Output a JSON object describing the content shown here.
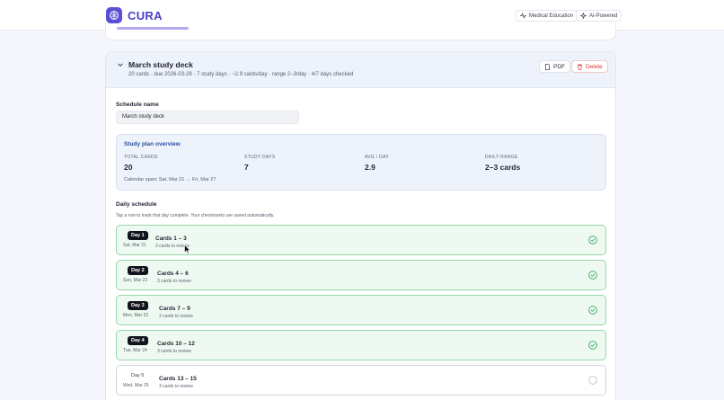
{
  "header": {
    "brand": "CURA",
    "pills": [
      {
        "label": "Medical Education",
        "icon": "pulse-icon"
      },
      {
        "label": "AI-Powered",
        "icon": "sparkle-icon"
      }
    ]
  },
  "deck": {
    "title": "March study deck",
    "meta": "20 cards · due 2026-03-28 · 7 study days · ~2.9 cards/day · range 2–3/day · 4/7 days checked",
    "pdf_label": "PDF",
    "delete_label": "Delete",
    "schedule_name_label": "Schedule name",
    "schedule_name_value": "March study deck"
  },
  "overview": {
    "title": "Study plan overview",
    "stats": [
      {
        "label": "TOTAL CARDS",
        "value": "20"
      },
      {
        "label": "STUDY DAYS",
        "value": "7"
      },
      {
        "label": "AVG / DAY",
        "value": "2.9"
      },
      {
        "label": "DAILY RANGE",
        "value": "2–3 cards"
      }
    ],
    "span": "Calendar span: Sat, Mar 21 → Fri, Mar 27"
  },
  "daily": {
    "title": "Daily schedule",
    "hint": "Tap a row to mark that day complete. Your checkmarks are saved automatically.",
    "rows": [
      {
        "day": "Day 1",
        "date": "Sat, Mar 21",
        "title": "Cards 1 – 3",
        "sub": "3 cards to review",
        "done": true
      },
      {
        "day": "Day 2",
        "date": "Sun, Mar 22",
        "title": "Cards 4 – 6",
        "sub": "3 cards to review",
        "done": true
      },
      {
        "day": "Day 3",
        "date": "Mon, Mar 23",
        "title": "Cards 7 – 9",
        "sub": "3 cards to review",
        "done": true
      },
      {
        "day": "Day 4",
        "date": "Tue, Mar 24",
        "title": "Cards 10 – 12",
        "sub": "3 cards to review",
        "done": true
      },
      {
        "day": "Day 5",
        "date": "Wed, Mar 25",
        "title": "Cards 13 – 15",
        "sub": "3 cards to review",
        "done": false
      }
    ]
  },
  "colors": {
    "brand": "#5b4fd6",
    "done_border": "#97d7a6",
    "done_bg": "#eefaf1",
    "check": "#3aa55a",
    "danger": "#d43b3b"
  }
}
